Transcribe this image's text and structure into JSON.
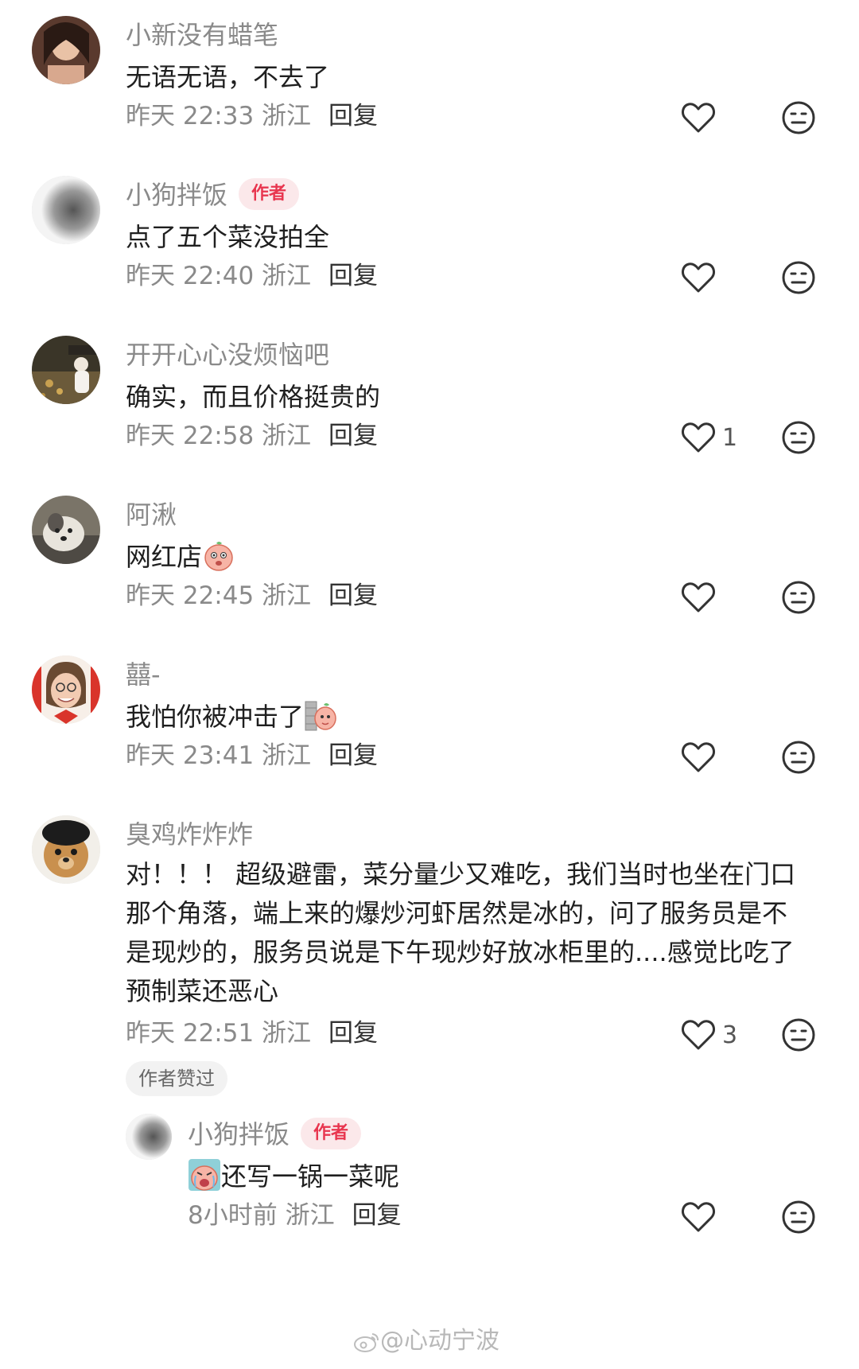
{
  "comments": [
    {
      "username": "小新没有蜡笔",
      "text": "无语无语，不去了",
      "time": "昨天 22:33 浙江",
      "reply": "回复",
      "likes": ""
    },
    {
      "username": "小狗拌饭",
      "badge": "作者",
      "text": "点了五个菜没拍全",
      "time": "昨天 22:40 浙江",
      "reply": "回复",
      "likes": ""
    },
    {
      "username": "开开心心没烦恼吧",
      "text": "确实，而且价格挺贵的",
      "time": "昨天 22:58 浙江",
      "reply": "回复",
      "likes": "1"
    },
    {
      "username": "阿湫",
      "text": "网红店",
      "time": "昨天 22:45 浙江",
      "reply": "回复",
      "likes": ""
    },
    {
      "username": "囍-",
      "text": "我怕你被冲击了",
      "time": "昨天 23:41 浙江",
      "reply": "回复",
      "likes": ""
    },
    {
      "username": "臭鸡炸炸炸",
      "text": "对！！！ 超级避雷，菜分量少又难吃，我们当时也坐在门口那个角落，端上来的爆炒河虾居然是冰的，问了服务员是不是现炒的，服务员说是下午现炒好放冰柜里的....感觉比吃了预制菜还恶心",
      "time": "昨天 22:51 浙江",
      "reply": "回复",
      "likes": "3",
      "liked_by_author": "作者赞过"
    }
  ],
  "sub_reply": {
    "username": "小狗拌饭",
    "badge": "作者",
    "text": "还写一锅一菜呢",
    "time": "8小时前 浙江",
    "reply": "回复",
    "likes": ""
  },
  "watermark": "@心动宁波",
  "colors": {
    "accent": "#e8364f",
    "badge_bg": "#fbe8ea",
    "meta_gray": "#8a8a8a"
  },
  "icons": [
    "heart-icon",
    "neutral-face-icon",
    "weibo-logo-icon"
  ]
}
